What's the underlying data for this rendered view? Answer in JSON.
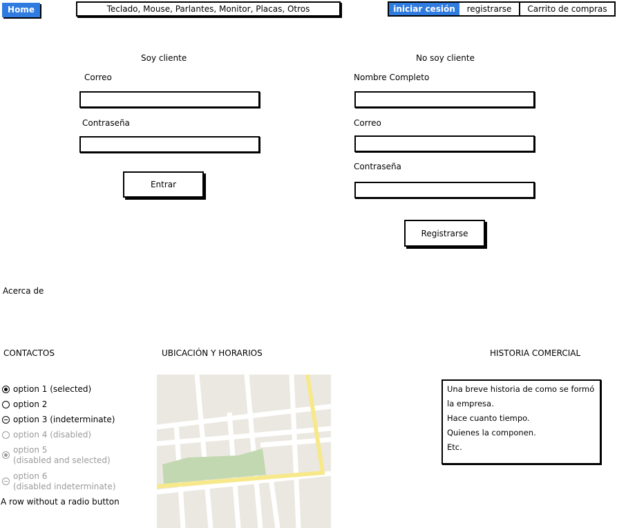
{
  "nav": {
    "home_label": "Home",
    "categories": "Teclado, Mouse, Parlantes, Monitor, Placas, Otros",
    "login_label": "iniciar cesión",
    "register_label": "registrarse",
    "cart_label": "Carrito de compras"
  },
  "client": {
    "heading": "Soy cliente",
    "email_label": "Correo",
    "password_label": "Contraseña",
    "submit_label": "Entrar"
  },
  "new_client": {
    "heading": "No soy cliente",
    "name_label": "Nombre Completo",
    "email_label": "Correo",
    "password_label": "Contraseña",
    "submit_label": "Registrarse"
  },
  "about": {
    "label": "Acerca de"
  },
  "contacts": {
    "heading": "CONTACTOS",
    "options": [
      {
        "label": "option 1 (selected)"
      },
      {
        "label": "option 2"
      },
      {
        "label": "option 3 (indeterminate)"
      },
      {
        "label": "option 4 (disabled)"
      },
      {
        "label": "option 5",
        "sub": "(disabled and selected)"
      },
      {
        "label": "option 6",
        "sub": "(disabled indeterminate)"
      }
    ],
    "no_radio_row": "A row without a radio button"
  },
  "location": {
    "heading": "UBICACIÓN Y HORARIOS"
  },
  "history": {
    "heading": "HISTORIA COMERCIAL",
    "lines": [
      "Una breve historia de como se formó",
      "la empresa.",
      "Hace cuanto tiempo.",
      "Quienes la componen.",
      "Etc."
    ]
  },
  "colors": {
    "accent": "#2f7be0",
    "map_bg": "#ebe8e1",
    "map_road_major": "#f7e88a",
    "map_park": "#c1d8b0"
  }
}
